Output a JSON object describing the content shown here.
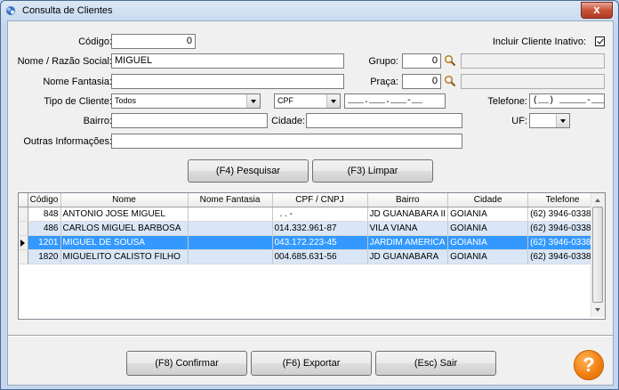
{
  "window": {
    "title": "Consulta de Clientes",
    "close_glyph": "x"
  },
  "form": {
    "codigo_label": "Código:",
    "codigo_value": "0",
    "incluir_inativo_label": "Incluir Cliente Inativo:",
    "nome_label": "Nome / Razão Social:",
    "nome_value": "MIGUEL",
    "grupo_label": "Grupo:",
    "grupo_value": "0",
    "fantasia_label": "Nome Fantasia:",
    "fantasia_value": "",
    "praca_label": "Praça:",
    "praca_value": "0",
    "tipo_label": "Tipo de Cliente:",
    "tipo_value": "Todos",
    "doc_type_value": "CPF",
    "doc_mask": "___.___.___-__",
    "telefone_label": "Telefone:",
    "telefone_mask": "(__) _____-____",
    "bairro_label": "Bairro:",
    "bairro_value": "",
    "cidade_label": "Cidade:",
    "cidade_value": "",
    "uf_label": "UF:",
    "uf_value": "",
    "outras_label": "Outras Informações:",
    "outras_value": ""
  },
  "buttons": {
    "pesquisar": "(F4) Pesquisar",
    "limpar": "(F3) Limpar",
    "confirmar": "(F8) Confirmar",
    "exportar": "(F6) Exportar",
    "sair": "(Esc) Sair",
    "help": "?"
  },
  "grid": {
    "columns": [
      "Código",
      "Nome",
      "Nome Fantasia",
      "CPF / CNPJ",
      "Bairro",
      "Cidade",
      "Telefone"
    ],
    "rows": [
      [
        "848",
        "ANTONIO JOSE MIGUEL",
        "",
        ". . -",
        "JD GUANABARA II",
        "GOIANIA",
        "(62)  3946-0338"
      ],
      [
        "486",
        "CARLOS MIGUEL BARBOSA",
        "",
        "014.332.961-87",
        "VILA VIANA",
        "GOIANIA",
        "(62)  3946-0338"
      ],
      [
        "1201",
        "MIGUEL DE SOUSA",
        "",
        "043.172.223-45",
        "JARDIM AMERICA",
        "GOIANIA",
        "(62)  3946-0338"
      ],
      [
        "1820",
        "MIGUELITO CALISTO FILHO",
        "",
        "004.685.631-56",
        "JD GUANABARA",
        "GOIANIA",
        "(62)  3946-0338"
      ]
    ],
    "selected_row_index": 2
  },
  "icons": {
    "app": "app-icon",
    "search": "magnifier-icon",
    "help": "help-icon",
    "row_pointer": "row-pointer-icon"
  },
  "colors": {
    "selection": "#3399ff",
    "alt_row": "#d9e6f7",
    "help": "#f07e12"
  }
}
